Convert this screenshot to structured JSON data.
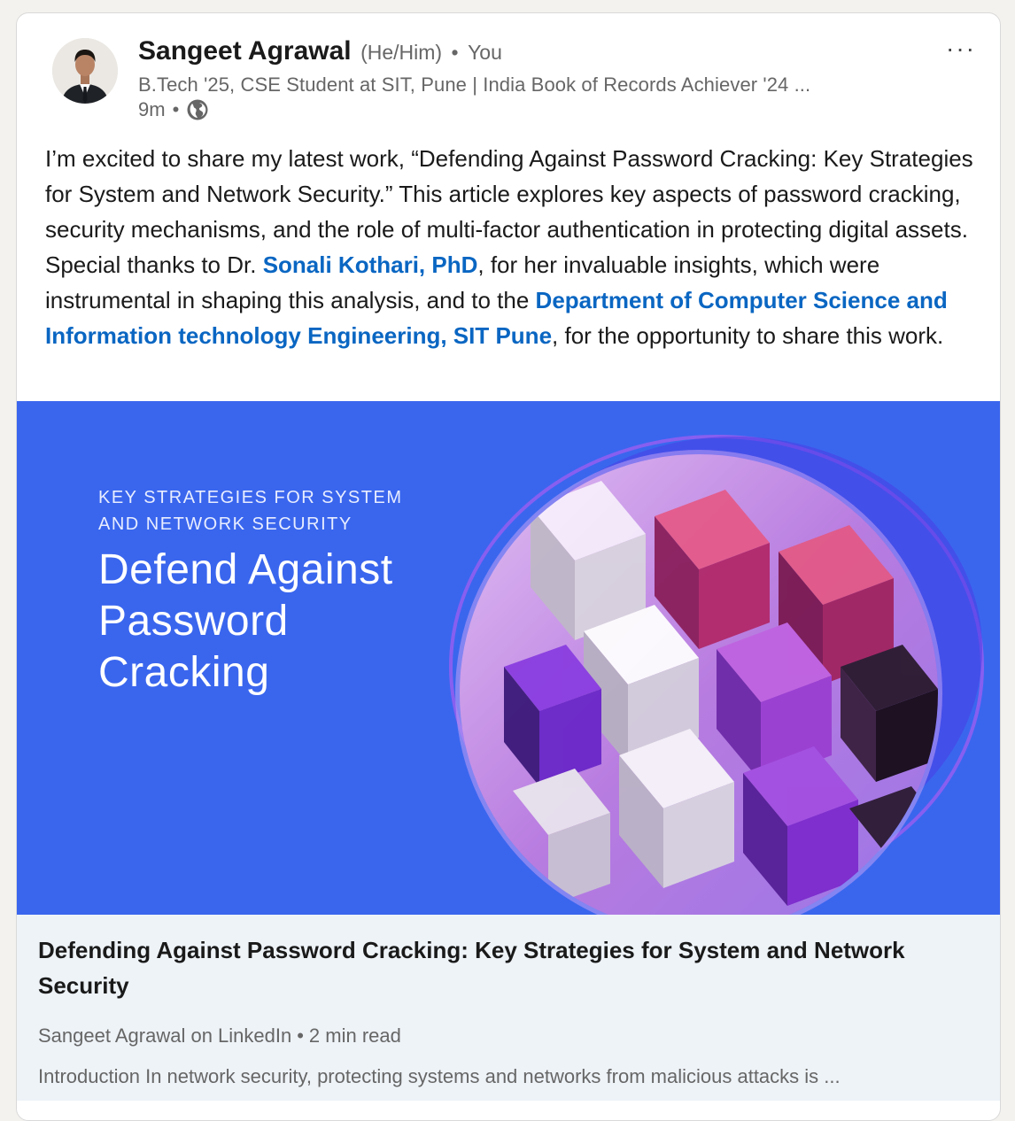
{
  "author": {
    "name": "Sangeet Agrawal",
    "pronouns": "(He/Him)",
    "relation": "You",
    "headline": "B.Tech '25, CSE Student at SIT, Pune | India Book of Records Achiever '24 ...",
    "time": "9m",
    "visibility_icon": "globe-icon"
  },
  "menu": {
    "more_label": "···"
  },
  "post": {
    "seg1": "I’m excited to share my latest work, “Defending Against Password Cracking: Key Strategies for System and Network Security.” This article explores key aspects of password cracking, security mechanisms, and the role of multi-factor authentication in protecting digital assets. Special thanks to Dr. ",
    "mention1": "Sonali Kothari, PhD",
    "seg2": ", for her invaluable insights, which were instrumental in shaping this analysis, and to the ",
    "mention2": "Department of Computer Science and Information technology Engineering, SIT Pune",
    "seg3": ", for the opportunity to share this work."
  },
  "image": {
    "kicker_line1": "KEY STRATEGIES FOR SYSTEM",
    "kicker_line2": "AND NETWORK SECURITY",
    "title_line1": "Defend Against",
    "title_line2": "Password",
    "title_line3": "Cracking"
  },
  "link_preview": {
    "title": "Defending Against Password Cracking: Key Strategies for System and Network Security",
    "source": "Sangeet Agrawal on LinkedIn",
    "read_time": "2 min read",
    "description": "Introduction In network security, protecting systems and networks from malicious attacks is ..."
  },
  "colors": {
    "link": "#0a66c2",
    "hero_bg": "#3a66ee",
    "preview_bg": "#eef3f8"
  }
}
